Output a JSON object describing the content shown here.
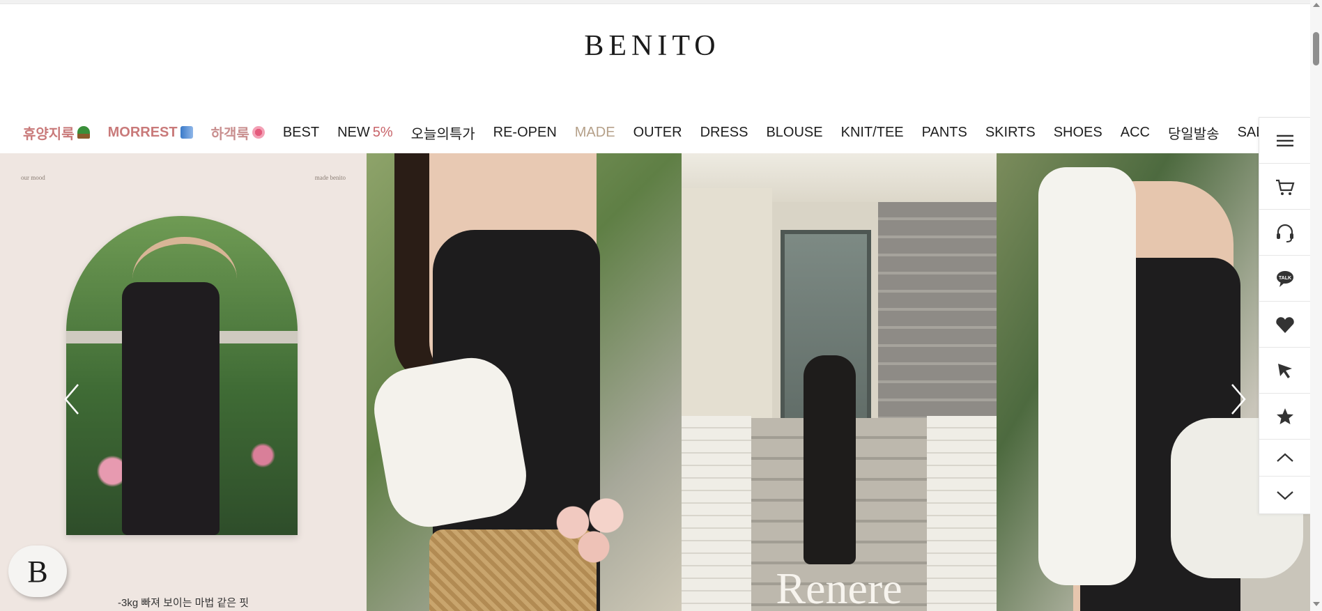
{
  "brand": {
    "logo_text": "BENITO"
  },
  "nav": {
    "items": [
      {
        "label": "휴양지룩",
        "icon": "palm-tree-emoji"
      },
      {
        "label": "MORREST",
        "icon": "thread-spool-emoji"
      },
      {
        "label": "하객룩",
        "icon": "bouquet-emoji"
      },
      {
        "label": "BEST"
      },
      {
        "label": "NEW",
        "accent": "5%"
      },
      {
        "label": "오늘의특가"
      },
      {
        "label": "RE-OPEN"
      },
      {
        "label": "MADE"
      },
      {
        "label": "OUTER"
      },
      {
        "label": "DRESS"
      },
      {
        "label": "BLOUSE"
      },
      {
        "label": "KNIT/TEE"
      },
      {
        "label": "PANTS"
      },
      {
        "label": "SKIRTS"
      },
      {
        "label": "SHOES"
      },
      {
        "label": "ACC"
      },
      {
        "label": "당일발송"
      },
      {
        "label": "SALE"
      }
    ]
  },
  "hero": {
    "panel1": {
      "corner_left": "our mood",
      "corner_right": "made benito",
      "caption": "-3kg 빠져 보이는 마법 같은 핏"
    },
    "panel3": {
      "watermark": "Renere"
    },
    "prev_icon": "chevron-left-icon",
    "next_icon": "chevron-right-icon"
  },
  "sidebar": {
    "items": [
      "menu-icon",
      "cart-icon",
      "headset-icon",
      "talk-icon",
      "heart-icon",
      "cursor-icon",
      "star-icon",
      "chevron-up-icon",
      "chevron-down-icon"
    ]
  },
  "badge": {
    "letter": "B"
  },
  "colors": {
    "pink": "#c97a7a",
    "accent": "#c8646a",
    "muted": "#b5a089"
  }
}
